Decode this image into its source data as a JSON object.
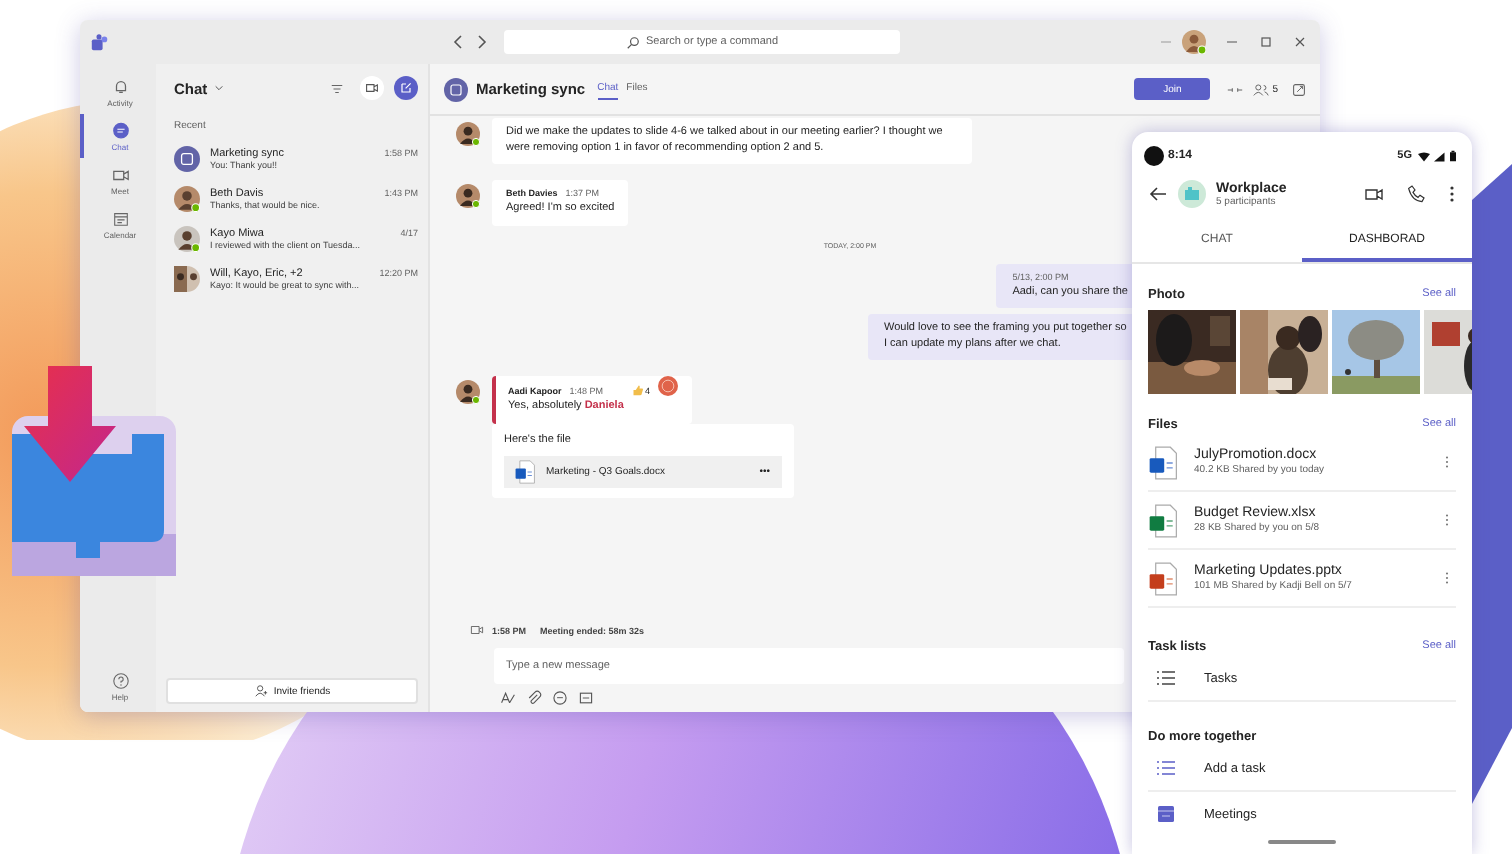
{
  "app": {
    "search_placeholder": "Search or type a command"
  },
  "rail": {
    "items": [
      {
        "label": "Activity",
        "kind": "bell",
        "selected": false
      },
      {
        "label": "Chat",
        "kind": "chat",
        "selected": true
      },
      {
        "label": "Meet",
        "kind": "video",
        "selected": false
      },
      {
        "label": "Calendar",
        "kind": "calendar",
        "selected": false
      }
    ],
    "help": "Help"
  },
  "chat_list": {
    "title": "Chat",
    "section": "Recent",
    "items": [
      {
        "name": "Marketing sync",
        "time": "1:58 PM",
        "preview": "You: Thank you!!",
        "kind": "group",
        "online": false
      },
      {
        "name": "Beth Davis",
        "time": "1:43 PM",
        "preview": "Thanks, that would be nice.",
        "kind": "person",
        "online": true
      },
      {
        "name": "Kayo Miwa",
        "time": "4/17",
        "preview": "I reviewed with the client on Tuesda...",
        "kind": "person",
        "online": true
      },
      {
        "name": "Will, Kayo, Eric, +2",
        "time": "12:20 PM",
        "preview": "Kayo: It would be great to sync with...",
        "kind": "multi",
        "online": false
      }
    ],
    "invite": "Invite friends"
  },
  "conversation": {
    "title": "Marketing sync",
    "tabs": [
      {
        "label": "Chat",
        "selected": true
      },
      {
        "label": "Files",
        "selected": false
      }
    ],
    "join": "Join",
    "participants": "5",
    "messages": [
      {
        "kind": "incoming",
        "text": "Did we make the updates to slide 4-6 we talked about in our meeting earlier? I thought we were removing option 1 in favor of recommending option 2 and 5.",
        "online": true
      },
      {
        "kind": "incoming",
        "author": "Beth Davies",
        "time": "1:37 PM",
        "text": "Agreed! I'm so excited",
        "online": true
      },
      {
        "kind": "divider",
        "text": "TODAY, 2:00 PM"
      },
      {
        "kind": "outgoing",
        "time": "5/13, 2:00 PM",
        "text": "Aadi, can you share the"
      },
      {
        "kind": "outgoing",
        "text": "Would love to see the framing you put together so I can update my plans after we chat."
      },
      {
        "kind": "mention",
        "author": "Aadi Kapoor",
        "time": "1:48 PM",
        "text": "Yes, absolutely",
        "mention": "Daniela",
        "reactions": "4",
        "online": true
      },
      {
        "kind": "file",
        "text": "Here's the file",
        "file": "Marketing - Q3 Goals.docx",
        "more": "•••"
      },
      {
        "kind": "meeting",
        "time": "1:58 PM",
        "text": "Meeting ended: 58m 32s"
      }
    ],
    "compose_placeholder": "Type a new message"
  },
  "phone": {
    "time": "8:14",
    "network": "5G",
    "title": "Workplace",
    "subtitle": "5 participants",
    "tabs": [
      {
        "label": "CHAT",
        "selected": false
      },
      {
        "label": "DASHBORAD",
        "selected": true
      }
    ],
    "photos": {
      "title": "Photo",
      "link": "See all"
    },
    "files": {
      "title": "Files",
      "link": "See all",
      "items": [
        {
          "name": "JulyPromotion.docx",
          "details": "40.2 KB Shared by you today",
          "kind": "docx"
        },
        {
          "name": "Budget Review.xlsx",
          "details": "28 KB Shared by you on 5/8",
          "kind": "xlsx"
        },
        {
          "name": "Marketing Updates.pptx",
          "details": "101 MB Shared by Kadji Bell on 5/7",
          "kind": "pptx"
        }
      ]
    },
    "tasks": {
      "title": "Task lists",
      "link": "See all",
      "items": [
        {
          "label": "Tasks",
          "kind": "list"
        }
      ]
    },
    "more": {
      "title": "Do more together",
      "items": [
        {
          "label": "Add a task",
          "kind": "list"
        },
        {
          "label": "Meetings",
          "kind": "calendar"
        }
      ]
    }
  }
}
